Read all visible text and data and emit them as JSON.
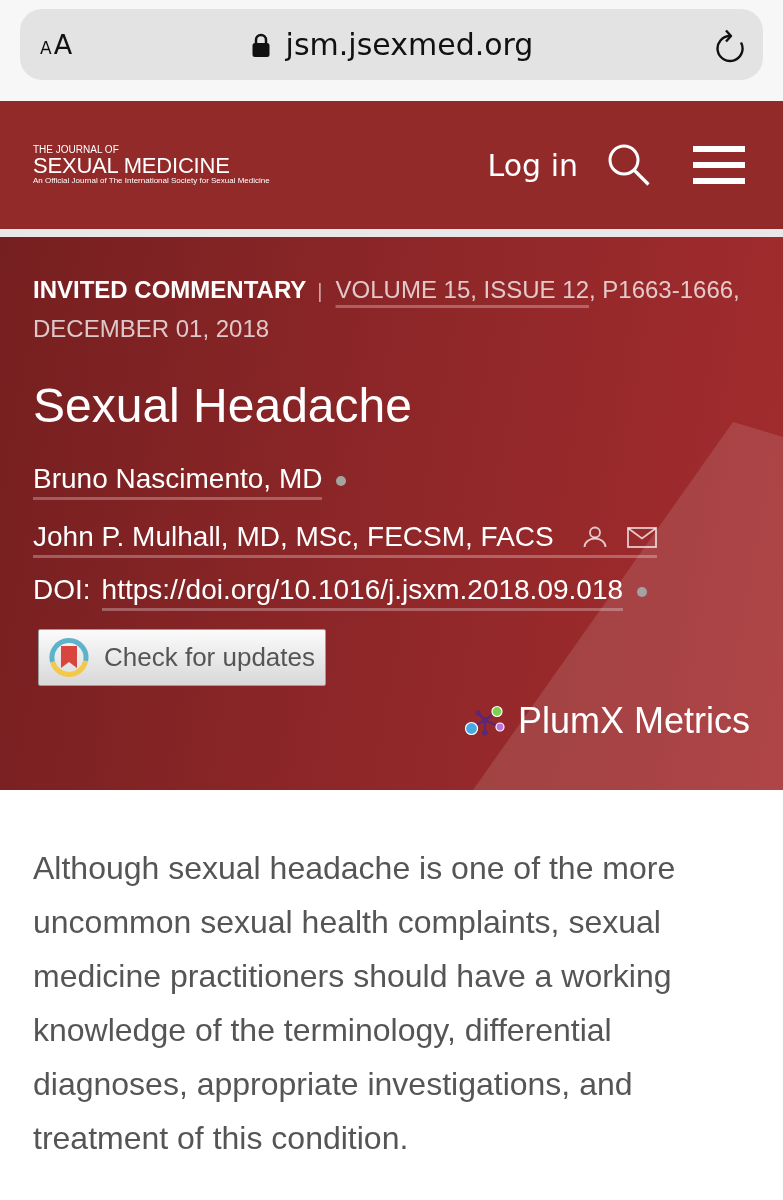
{
  "browser": {
    "text_size": {
      "small": "A",
      "large": "A"
    },
    "url": "jsm.jsexmed.org"
  },
  "header": {
    "logo": {
      "overline": "THE JOURNAL OF",
      "title": "SEXUAL MEDICINE",
      "tagline": "An Official Journal of The International Society for Sexual Medicine"
    },
    "login": "Log in"
  },
  "article": {
    "type": "INVITED COMMENTARY",
    "separator": "|",
    "issue_link": "VOLUME 15, ISSUE 12",
    "pages": ", P1663-1666,",
    "date": "DECEMBER 01, 2018",
    "title": "Sexual Headache",
    "authors": [
      {
        "name": "Bruno Nascimento, MD",
        "kind": "plain"
      },
      {
        "name": "John P. Mulhall, MD, MSc, FECSM, FACS",
        "kind": "corresponding"
      }
    ],
    "doi": {
      "label": "DOI:",
      "link": "https://doi.org/10.1016/j.jsxm.2018.09.018"
    },
    "updates_button": "Check for updates",
    "metrics_link": "PlumX Metrics"
  },
  "abstract": "Although sexual headache is one of the more uncommon sexual health complaints, sexual medicine practitioners should have a working knowledge of the terminology, differential diagnoses, appropriate investigations, and treatment of this condition."
}
